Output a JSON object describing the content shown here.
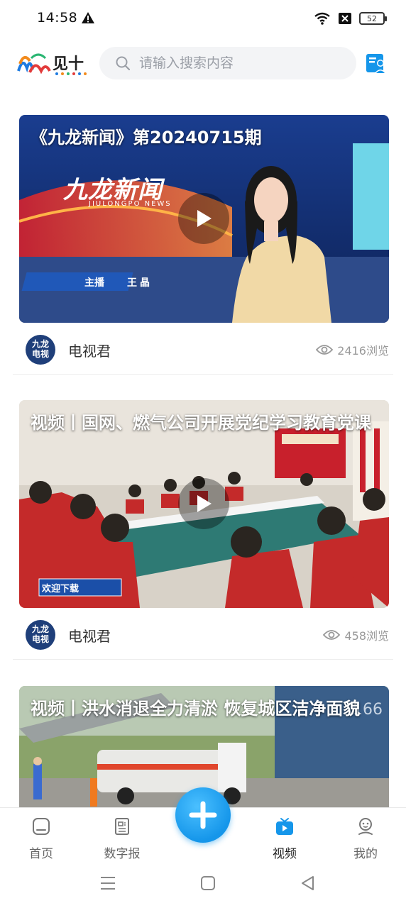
{
  "status_bar": {
    "time": "14:58",
    "battery": "52"
  },
  "header": {
    "logo_text": "见十",
    "search_placeholder": "请输入搜索内容"
  },
  "feed": [
    {
      "title": "《九龙新闻》第20240715期",
      "overlay_logo": "九龙新闻",
      "overlay_sub": "JIULONGPO NEWS",
      "overlay_anchor_label": "主播",
      "overlay_anchor_name": "王晶",
      "author": "电视君",
      "views": "2416浏览"
    },
    {
      "title": "视频丨国网、燃气公司开展党纪学习教育党课",
      "overlay_banner": "欢迎下载",
      "author": "电视君",
      "views": "458浏览"
    },
    {
      "title": "视频丨洪水消退全力清淤 恢复城区洁净面貌"
    }
  ],
  "avatar_text": {
    "line1": "九龙",
    "line2": "电视"
  },
  "tabbar": {
    "items": [
      {
        "label": "首页",
        "icon": "home-icon"
      },
      {
        "label": "数字报",
        "icon": "newspaper-icon"
      },
      {
        "label": "视频",
        "icon": "tv-icon"
      },
      {
        "label": "我的",
        "icon": "user-icon"
      }
    ],
    "active": "视频"
  },
  "colors": {
    "accent": "#1596ea",
    "text_secondary": "#999999"
  }
}
